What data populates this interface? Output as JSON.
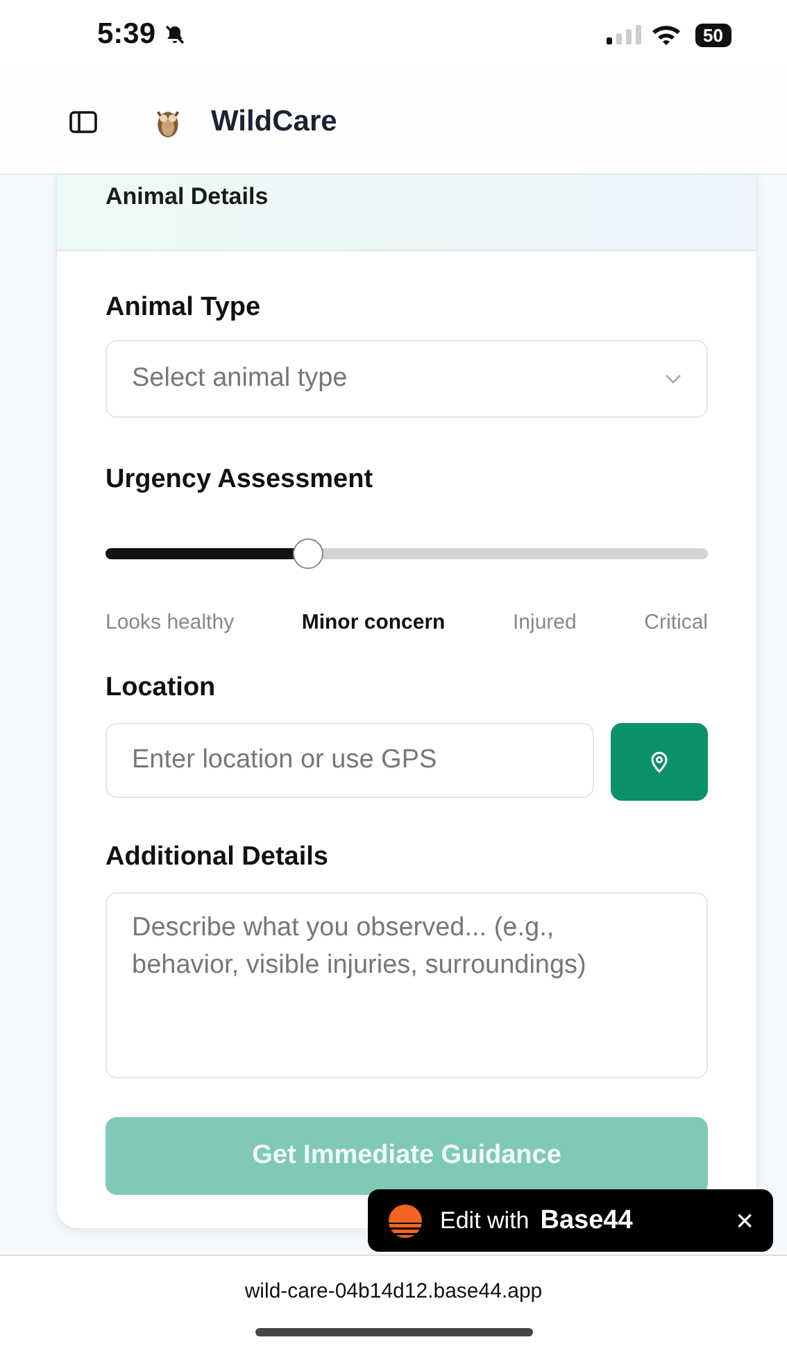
{
  "status_bar": {
    "time": "5:39",
    "battery": "50"
  },
  "header": {
    "title": "WildCare"
  },
  "card": {
    "title": "Animal Details",
    "animal_type": {
      "label": "Animal Type",
      "placeholder": "Select animal type"
    },
    "urgency": {
      "label": "Urgency Assessment",
      "level": 0.336,
      "options": [
        {
          "label": "Looks healthy",
          "selected": false
        },
        {
          "label": "Minor concern",
          "selected": true
        },
        {
          "label": "Injured",
          "selected": false
        },
        {
          "label": "Critical",
          "selected": false
        }
      ]
    },
    "location": {
      "label": "Location",
      "placeholder": "Enter location or use GPS"
    },
    "details": {
      "label": "Additional Details",
      "placeholder": "Describe what you observed... (e.g., behavior, visible injuries, surroundings)"
    },
    "submit": {
      "label": "Get Immediate Guidance",
      "disabled": true
    }
  },
  "badge": {
    "prefix": "Edit with",
    "brand": "Base44",
    "close": "×"
  },
  "browser": {
    "url": "wild-care-04b14d12.base44.app"
  }
}
